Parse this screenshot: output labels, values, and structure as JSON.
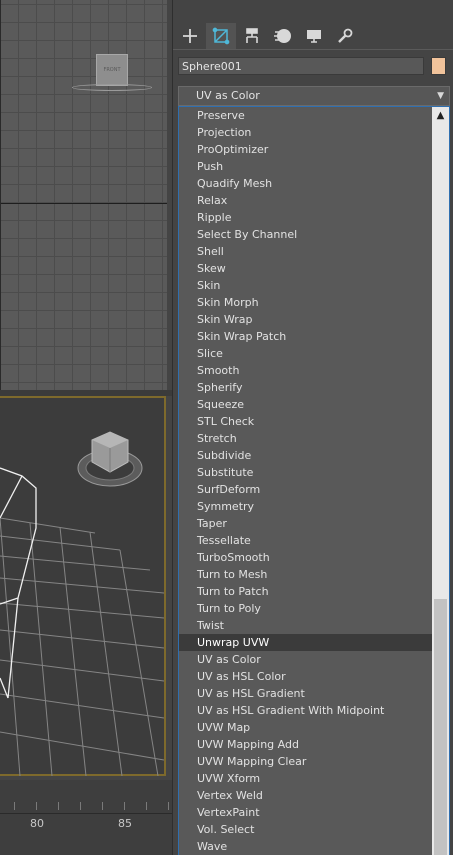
{
  "tabs": [
    {
      "icon": "create-plus-icon"
    },
    {
      "icon": "modify-icon"
    },
    {
      "icon": "hierarchy-icon"
    },
    {
      "icon": "motion-icon"
    },
    {
      "icon": "display-icon"
    },
    {
      "icon": "utilities-wrench-icon"
    }
  ],
  "object": {
    "name": "Sphere001",
    "color": "#f1c39b"
  },
  "modifier_list": {
    "selected_value": "UV as Color",
    "highlighted": "Unwrap UVW",
    "items": [
      "Preserve",
      "Projection",
      "ProOptimizer",
      "Push",
      "Quadify Mesh",
      "Relax",
      "Ripple",
      "Select By Channel",
      "Shell",
      "Skew",
      "Skin",
      "Skin Morph",
      "Skin Wrap",
      "Skin Wrap Patch",
      "Slice",
      "Smooth",
      "Spherify",
      "Squeeze",
      "STL Check",
      "Stretch",
      "Subdivide",
      "Substitute",
      "SurfDeform",
      "Symmetry",
      "Taper",
      "Tessellate",
      "TurboSmooth",
      "Turn to Mesh",
      "Turn to Patch",
      "Turn to Poly",
      "Twist",
      "Unwrap UVW",
      "UV as Color",
      "UV as HSL Color",
      "UV as HSL Gradient",
      "UV as HSL Gradient With Midpoint",
      "UVW Map",
      "UVW Mapping Add",
      "UVW Mapping Clear",
      "UVW Xform",
      "Vertex Weld",
      "VertexPaint",
      "Vol. Select",
      "Wave"
    ]
  },
  "viewcube_top_label": "FRONT",
  "timeline": {
    "labels": [
      "80",
      "85"
    ]
  },
  "colors": {
    "accent_border": "#2f6fb0",
    "viewport_active": "#7e6a2c"
  }
}
